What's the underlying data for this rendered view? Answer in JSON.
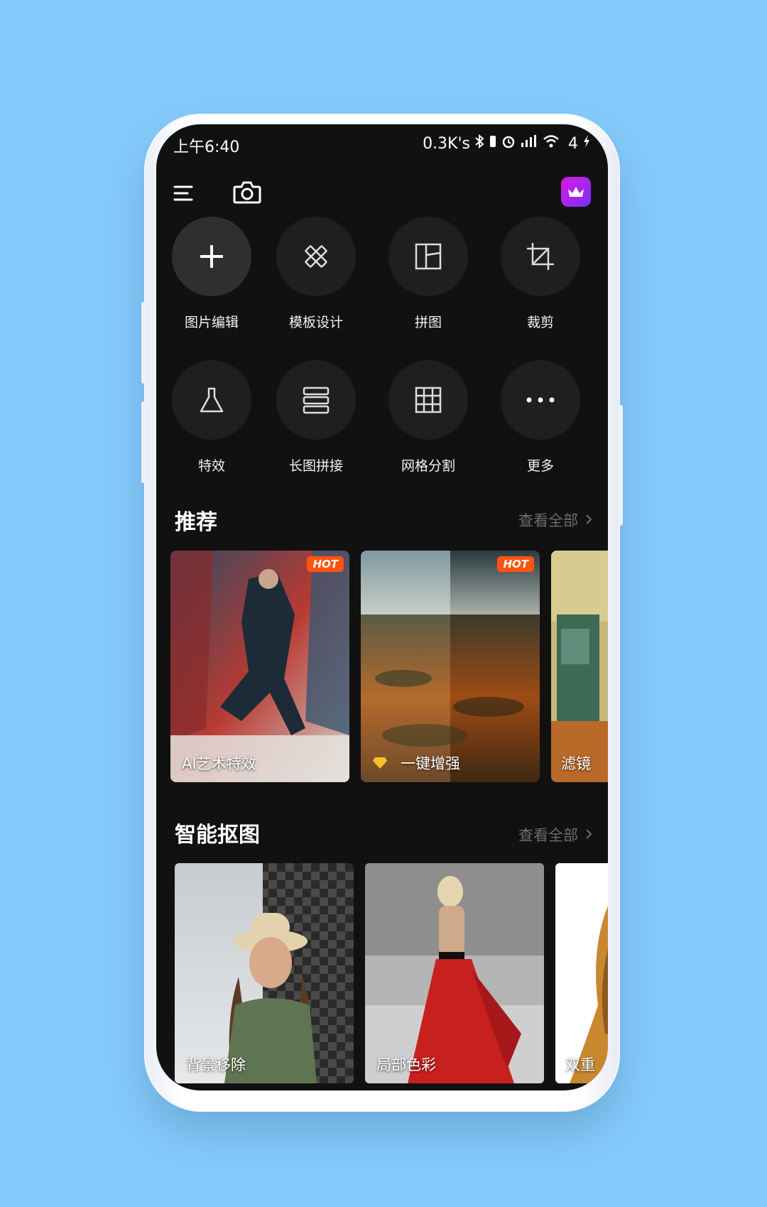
{
  "status_bar": {
    "time": "上午6:40",
    "network_speed": "0.3K's",
    "battery_level": "4",
    "icons": [
      "bluetooth-icon",
      "vibrate-icon",
      "alarm-icon",
      "signal-icon",
      "wifi-icon",
      "charging-icon"
    ]
  },
  "toolbar": {
    "menu_icon": "menu-icon",
    "camera_icon": "camera-icon",
    "vip_icon": "crown-icon"
  },
  "tools": [
    {
      "label": "图片编辑",
      "icon": "plus-icon"
    },
    {
      "label": "模板设计",
      "icon": "ruler-pencil-icon"
    },
    {
      "label": "拼图",
      "icon": "collage-icon"
    },
    {
      "label": "裁剪",
      "icon": "crop-icon"
    },
    {
      "label": "特效",
      "icon": "flask-icon"
    },
    {
      "label": "长图拼接",
      "icon": "stack-icon"
    },
    {
      "label": "网格分割",
      "icon": "grid-icon"
    },
    {
      "label": "更多",
      "icon": "more-icon"
    }
  ],
  "recommend": {
    "title": "推荐",
    "view_all": "查看全部",
    "cards": [
      {
        "label": "AI艺术特效",
        "badge": "HOT"
      },
      {
        "label": "一键增强",
        "badge": "HOT"
      },
      {
        "label": "滤镜",
        "badge": ""
      }
    ]
  },
  "cutout": {
    "title": "智能抠图",
    "view_all": "查看全部",
    "cards": [
      {
        "label": "背景移除"
      },
      {
        "label": "局部色彩"
      },
      {
        "label": "双重"
      }
    ]
  },
  "colors": {
    "background": "#85cbfc",
    "screen": "#111111",
    "hot": "#ff5312",
    "vip_start": "#d81be3",
    "vip_end": "#7b2ff7"
  }
}
